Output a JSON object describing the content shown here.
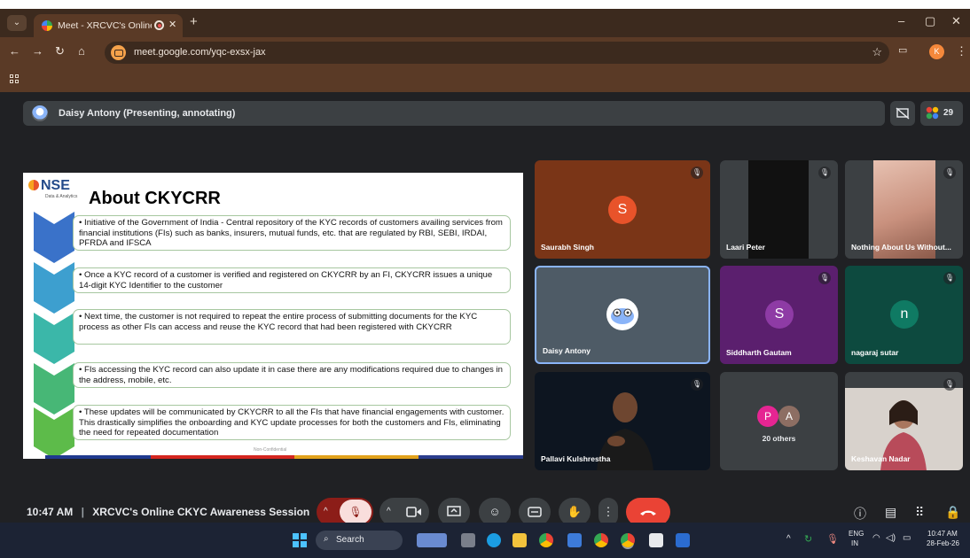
{
  "browser": {
    "tab_title": "Meet - XRCVC's Online CKYC Awareness Session",
    "new_tab": "+",
    "url": "meet.google.com/yqc-exsx-jax",
    "profile_initial": "K",
    "win_min": "–",
    "win_restore": "▢",
    "win_close": "✕"
  },
  "meet": {
    "presenter_banner": "Daisy Antony (Presenting, annotating)",
    "participant_count": "29",
    "meeting_time": "10:47 AM",
    "meeting_title": "XRCVC's Online CKYC Awareness Session"
  },
  "slide": {
    "logo": "NSE",
    "logo_sub": "Data & Analytics",
    "title": "About CKYCRR",
    "bullets": [
      "Initiative of the Government of India -  Central repository of the KYC records of customers availing services from financial institutions (FIs) such as banks, insurers, mutual funds, etc. that are regulated by RBI, SEBI, IRDAI, PFRDA and IFSCA",
      "Once a KYC record of a customer is verified and registered on CKYCRR by an FI, CKYCRR issues a unique 14-digit KYC Identifier to the customer",
      "Next time, the customer is not required to repeat the entire process of submitting documents for the KYC process as other FIs can access and reuse the KYC record that had been registered with CKYCRR",
      "FIs accessing the KYC record can also update it in case there are any modifications required due to changes in the address, mobile, etc.",
      "These updates will be communicated by CKYCRR to all the FIs that have financial engagements with customer. This drastically simplifies the onboarding and KYC update processes for both the customers and FIs, eliminating the need for repeated documentation"
    ],
    "footer": "Non-Confidential"
  },
  "participants": [
    {
      "name": "Saurabh Singh",
      "initial": "S",
      "color": "#e8532a"
    },
    {
      "name": "Laari Peter"
    },
    {
      "name": "Nothing About Us Without..."
    },
    {
      "name": "Daisy Antony"
    },
    {
      "name": "Siddharth Gautam",
      "initial": "S",
      "color": "#8e3ba5"
    },
    {
      "name": "nagaraj sutar",
      "initial": "n",
      "color": "#0f7a63"
    },
    {
      "name": "Pallavi Kulshrestha"
    },
    {
      "name": "20 others",
      "initials": [
        "P",
        "A"
      ]
    },
    {
      "name": "Keshavan Nadar"
    }
  ],
  "taskbar": {
    "search_label": "Search",
    "lang_top": "ENG",
    "lang_bottom": "IN",
    "time": "10:47 AM",
    "date": "28-Feb-26"
  }
}
